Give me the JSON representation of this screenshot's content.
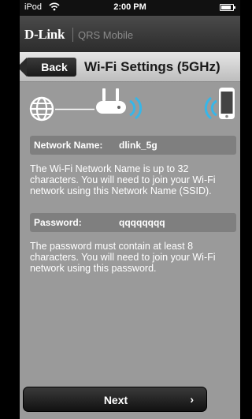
{
  "status_bar": {
    "carrier": "iPod",
    "time": "2:00 PM"
  },
  "brand": {
    "logo": "D-Link",
    "app_name": "QRS Mobile"
  },
  "nav": {
    "back_label": "Back",
    "title": "Wi-Fi Settings (5GHz)"
  },
  "network_name": {
    "label": "Network Name:",
    "value": "dlink_5g",
    "help": "The Wi-Fi Network Name is up to 32 characters. You will need to join your Wi-Fi network using this Network Name (SSID)."
  },
  "password": {
    "label": "Password:",
    "value": "qqqqqqqq",
    "help": "The password must contain at least 8 characters. You will need to join your Wi-Fi network using this password."
  },
  "footer": {
    "next_label": "Next",
    "next_chevron": "›"
  },
  "diagram": {
    "icons": [
      "globe-icon",
      "router-icon",
      "wireless-signal-icon",
      "smartphone-icon"
    ]
  },
  "colors": {
    "background": "#9a9a9a",
    "field_bg": "#7f7f7f",
    "signal_blue": "#37b6e8"
  }
}
